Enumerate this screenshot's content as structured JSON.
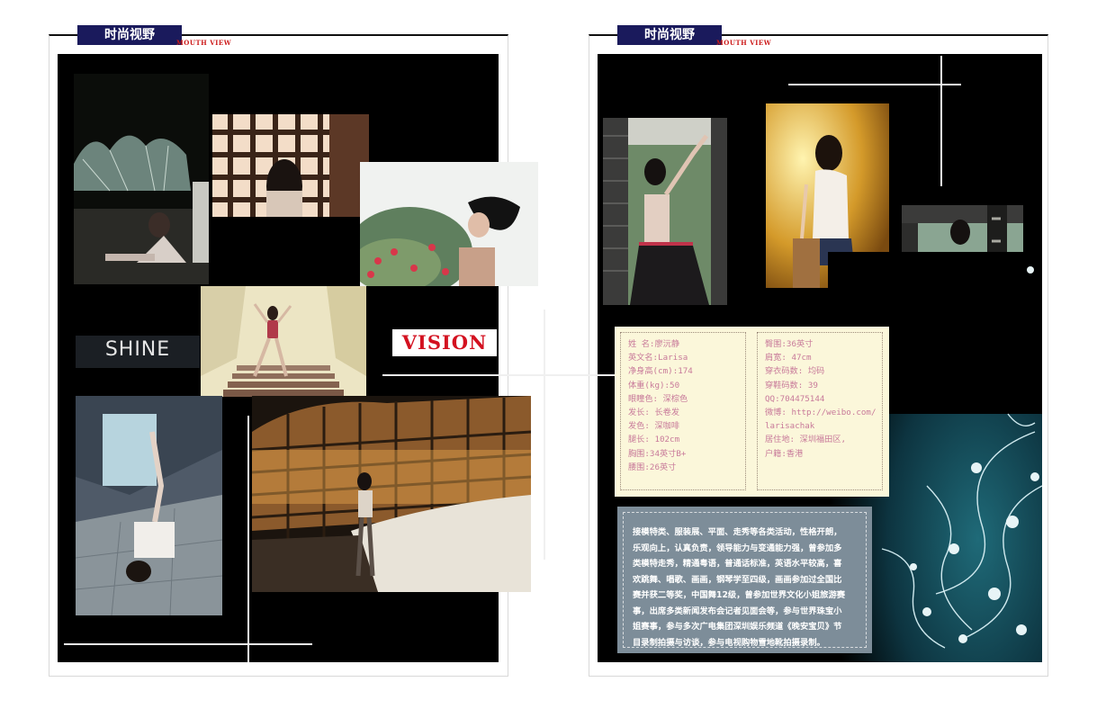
{
  "header": {
    "left": {
      "section_title": "时尚视野",
      "subtitle": "MOUTH VIEW"
    },
    "right": {
      "section_title": "时尚视野",
      "subtitle": "MOUTH VIEW"
    }
  },
  "logos": {
    "vision": "VISION",
    "shine": "SHINE"
  },
  "profile": {
    "left_column": [
      "姓 名:廖沅静",
      "英文名:Larisa",
      "净身高(cm):174",
      "体重(kg):50",
      "眼瞳色: 深棕色",
      "发长: 长卷发",
      "发色: 深咖啡",
      "腿长: 102cm",
      "胸围:34英寸B+",
      "腰围:26英寸"
    ],
    "right_column": [
      "臀围:36英寸",
      "肩宽: 47cm",
      "穿衣码数: 均码",
      "穿鞋码数: 39",
      "QQ:704475144",
      "微博: http://weibo.com/",
      "larisachak",
      "居住地: 深圳福田区,",
      "户籍:香港"
    ]
  },
  "bio": {
    "lines": [
      "接模特类、服装展、平面、走秀等各类活动，性格开朗，",
      "乐观向上，认真负责，领导能力与变通能力强，曾参加多",
      "类模特走秀，精通粤语，普通话标准，英语水平较高，喜",
      "欢跳舞、唱歌、画画，钢琴学至四级，画画参加过全国比",
      "赛并获二等奖，中国舞12级，曾参加世界文化小姐旅游赛",
      "事，出席多类新闻发布会记者见面会等，参与世界珠宝小",
      "姐赛事，参与多次广电集团深圳娱乐频道《晚安宝贝》节",
      "目录制拍摄与访谈，参与电视购物雪地靴拍摄录制。"
    ]
  },
  "colors": {
    "tab_bg": "#1a1a5c",
    "subtitle_red": "#cc1a1a",
    "vision_red": "#d31120",
    "info_bg": "#fbf7da",
    "info_text": "#c87a9a",
    "bio_bg": "#7d8d99"
  },
  "photos": [
    "photo-glass-dome-night",
    "photo-window-lattice",
    "photo-flowers-hair",
    "photo-stairs",
    "photo-lying-pose",
    "photo-building-night",
    "photo-brick-pillar",
    "photo-warm-light",
    "photo-pavilion",
    "floral-ornament"
  ]
}
